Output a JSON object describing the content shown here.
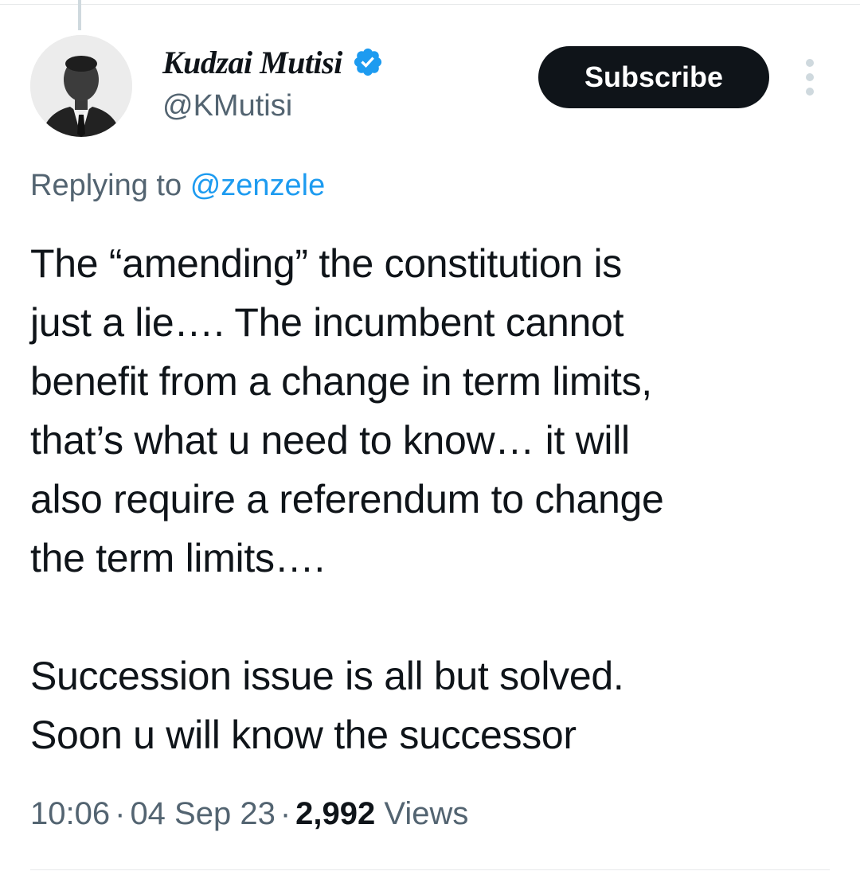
{
  "tweet": {
    "author": {
      "display_name": "Kudzai Mutisi",
      "handle": "@KMutisi",
      "verified": true
    },
    "subscribe_label": "Subscribe",
    "replying_prefix": "Replying to",
    "replying_to": "@zenzele",
    "text_lines": [
      "The “amending” the constitution is",
      "just a lie…. The incumbent cannot",
      "benefit from a change in term limits,",
      "that’s what u need to know… it will",
      "also require a referendum to change",
      "the term limits….",
      "",
      "Succession issue is all but solved.",
      "Soon u will know the successor"
    ],
    "meta": {
      "time": "10:06",
      "date": "04 Sep 23",
      "separator": "·",
      "views_count": "2,992",
      "views_label": "Views"
    }
  },
  "colors": {
    "text": "#0f1419",
    "secondary": "#536471",
    "link": "#1d9bf0",
    "button_bg": "#0f1419",
    "verified": "#1d9bf0"
  },
  "icons": {
    "verified": "verified-badge-icon",
    "more": "more-vertical-icon"
  }
}
